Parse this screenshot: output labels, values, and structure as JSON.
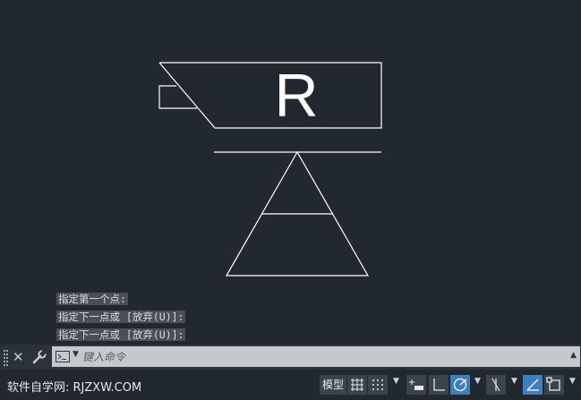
{
  "drawing": {
    "r_label": "R"
  },
  "command_history": [
    "指定第一个点:",
    "指定下一点或 [放弃(U)]:",
    "指定下一点或 [放弃(U)]:"
  ],
  "command_line": {
    "placeholder": "键入命令"
  },
  "status_bar": {
    "watermark": "软件自学网: RJZXW.COM",
    "model_label": "模型"
  },
  "colors": {
    "background": "#212830",
    "line": "#ffffff",
    "active": "#3d7fc1"
  }
}
